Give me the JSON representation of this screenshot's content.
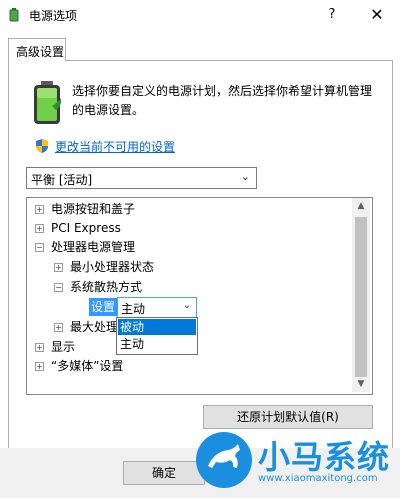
{
  "window": {
    "title": "电源选项",
    "help_glyph": "?",
    "close_glyph": "✕"
  },
  "tab": {
    "label": "高级设置"
  },
  "description": "选择你要自定义的电源计划，然后选择你希望计算机管理的电源设置。",
  "change_link": "更改当前不可用的设置",
  "plan_select": {
    "value": "平衡 [活动]"
  },
  "tree": {
    "items": [
      {
        "label": "电源按钮和盖子",
        "expander": "+",
        "level": 0
      },
      {
        "label": "PCI Express",
        "expander": "+",
        "level": 0
      },
      {
        "label": "处理器电源管理",
        "expander": "−",
        "level": 0
      },
      {
        "label": "最小处理器状态",
        "expander": "+",
        "level": 1
      },
      {
        "label": "系统散热方式",
        "expander": "−",
        "level": 1
      },
      {
        "label": "最大处理",
        "expander": "+",
        "level": 1
      },
      {
        "label": "显示",
        "expander": "+",
        "level": 0
      },
      {
        "label": "“多媒体”设置",
        "expander": "+",
        "level": 0
      }
    ],
    "setting_label": "设置",
    "setting_value": "主动",
    "dropdown_options": [
      "被动",
      "主动"
    ]
  },
  "restore_button": "还原计划默认值(R)",
  "ok_button": "确定",
  "watermark": {
    "name": "小马系统",
    "url": "www.xiaomaxitong.com"
  },
  "colors": {
    "link": "#0066cc",
    "selection": "#0078d7",
    "watermark": "#1a8fe0"
  }
}
